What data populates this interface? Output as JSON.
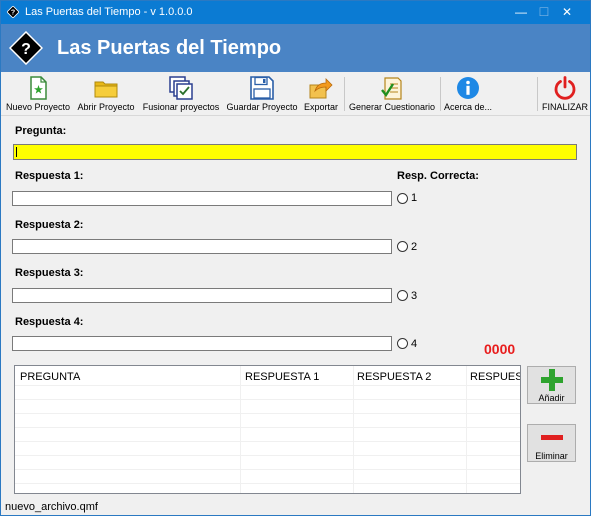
{
  "window": {
    "title": "Las Puertas del Tiempo - v 1.0.0.0",
    "min_glyph": "—",
    "max_glyph": "☐",
    "close_glyph": "✕"
  },
  "banner": {
    "logo_glyph": "?",
    "title": "Las Puertas del Tiempo"
  },
  "toolbar": {
    "items": [
      {
        "label": "Nuevo Proyecto",
        "icon": "new-file-icon"
      },
      {
        "label": "Abrir Proyecto",
        "icon": "folder-icon"
      },
      {
        "label": "Fusionar proyectos",
        "icon": "merge-icon"
      },
      {
        "label": "Guardar Proyecto",
        "icon": "floppy-disk-icon"
      },
      {
        "label": "Exportar",
        "icon": "export-icon"
      },
      {
        "label": "Generar Cuestionario",
        "icon": "checklist-icon"
      },
      {
        "label": "Acerca de...",
        "icon": "info-icon"
      },
      {
        "label": "FINALIZAR",
        "icon": "power-icon"
      }
    ]
  },
  "form": {
    "pregunta_label": "Pregunta:",
    "pregunta_value": "",
    "resp_correcta_label": "Resp. Correcta:",
    "answers": [
      {
        "label": "Respuesta 1:",
        "value": "",
        "option": "1"
      },
      {
        "label": "Respuesta 2:",
        "value": "",
        "option": "2"
      },
      {
        "label": "Respuesta 3:",
        "value": "",
        "option": "3"
      },
      {
        "label": "Respuesta 4:",
        "value": "",
        "option": "4"
      }
    ],
    "counter": "0000"
  },
  "table": {
    "columns": [
      "PREGUNTA",
      "RESPUESTA 1",
      "RESPUESTA 2",
      "RESPUES"
    ],
    "rows": []
  },
  "buttons": {
    "add_label": "Añadir",
    "delete_label": "Eliminar"
  },
  "status": {
    "filename": "nuevo_archivo.qmf"
  },
  "colors": {
    "titlebar": "#0b7bd3",
    "banner": "#4a84c5",
    "question_field": "#ffff00",
    "counter": "#e81c1c",
    "add": "#2ea32e",
    "delete": "#e02020"
  }
}
